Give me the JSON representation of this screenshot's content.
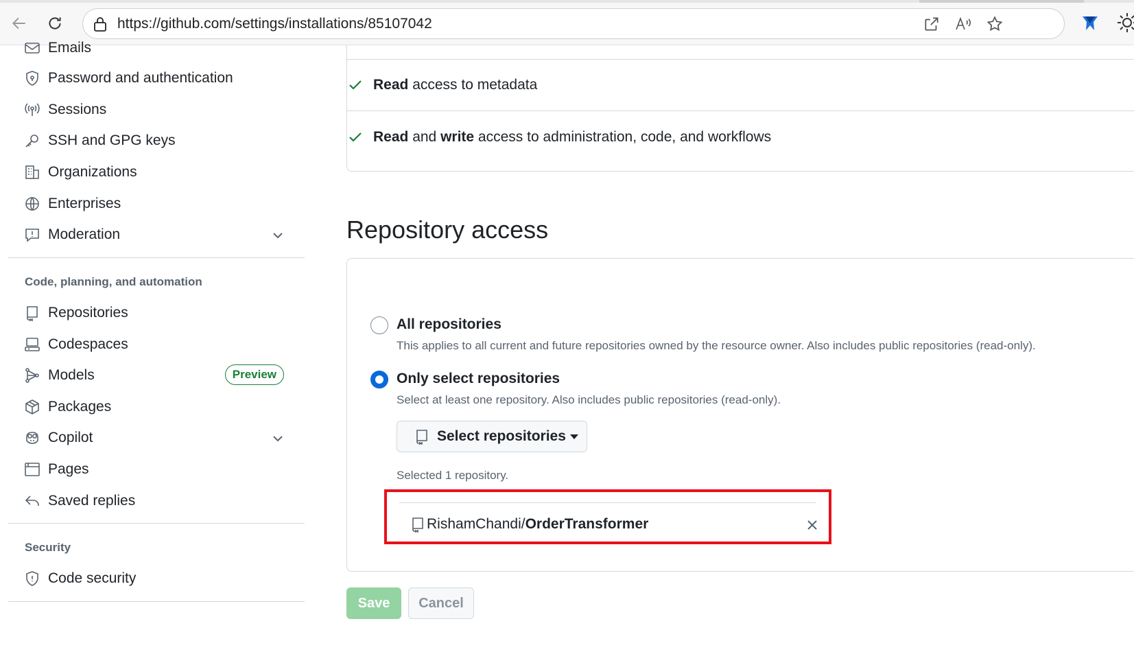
{
  "browser": {
    "url": "https://github.com/settings/installations/85107042"
  },
  "sidebar": {
    "items_top": [
      {
        "label": "Emails",
        "icon": "mail-icon"
      },
      {
        "label": "Password and authentication",
        "icon": "shield-lock-icon"
      },
      {
        "label": "Sessions",
        "icon": "broadcast-icon"
      },
      {
        "label": "SSH and GPG keys",
        "icon": "key-icon"
      },
      {
        "label": "Organizations",
        "icon": "organization-icon"
      },
      {
        "label": "Enterprises",
        "icon": "globe-icon"
      },
      {
        "label": "Moderation",
        "icon": "report-icon"
      }
    ],
    "section_code": "Code, planning, and automation",
    "items_code": [
      {
        "label": "Repositories",
        "icon": "repo-icon"
      },
      {
        "label": "Codespaces",
        "icon": "codespaces-icon"
      },
      {
        "label": "Models",
        "icon": "ai-model-icon",
        "badge": "Preview"
      },
      {
        "label": "Packages",
        "icon": "package-icon"
      },
      {
        "label": "Copilot",
        "icon": "copilot-icon"
      },
      {
        "label": "Pages",
        "icon": "browser-icon"
      },
      {
        "label": "Saved replies",
        "icon": "reply-icon"
      }
    ],
    "section_security": "Security",
    "items_security": [
      {
        "label": "Code security",
        "icon": "shield-icon"
      }
    ]
  },
  "permissions": {
    "row1": {
      "bold": "Read",
      "rest": " access to metadata"
    },
    "row2": {
      "bold1": "Read",
      "mid": " and ",
      "bold2": "write",
      "rest": " access to administration, code, and workflows"
    }
  },
  "repo_access": {
    "title": "Repository access",
    "all": {
      "label": "All repositories",
      "desc": "This applies to all current and future repositories owned by the resource owner. Also includes public repositories (read-only).",
      "selected": false
    },
    "select": {
      "label": "Only select repositories",
      "desc": "Select at least one repository. Also includes public repositories (read-only).",
      "selected": true
    },
    "select_button": "Select repositories",
    "selected_count": "Selected 1 repository.",
    "repo_owner": "RishamChandi/",
    "repo_name": "OrderTransformer"
  },
  "actions": {
    "save": "Save",
    "cancel": "Cancel"
  },
  "colors": {
    "accent": "#0969da",
    "success": "#1a7f37",
    "highlight": "#e8101a"
  }
}
